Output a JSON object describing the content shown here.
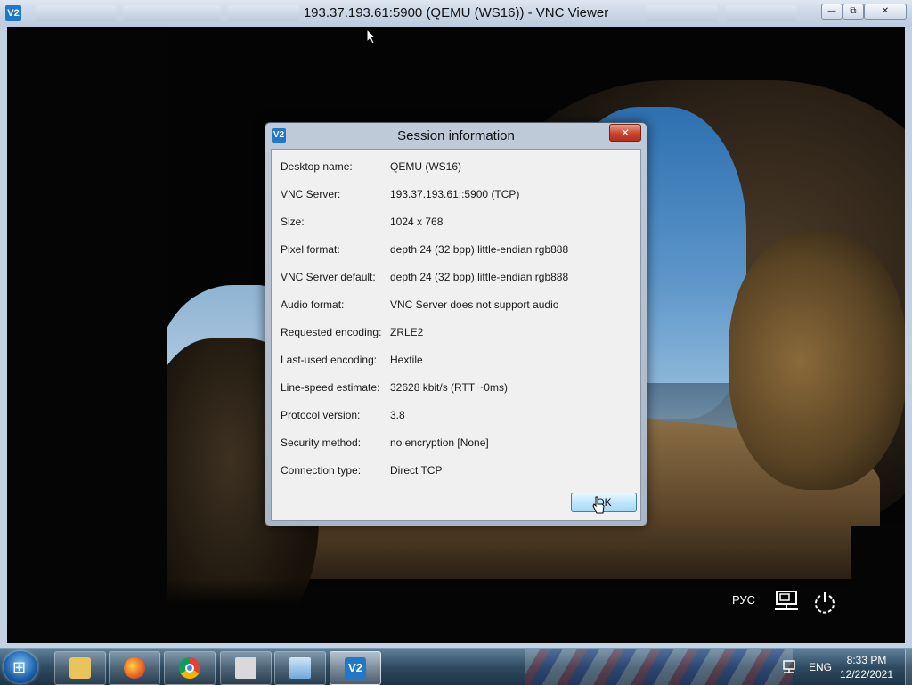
{
  "window": {
    "title": "193.37.193.61:5900 (QEMU (WS16)) - VNC Viewer",
    "logo_text": "V2",
    "minimize_glyph": "—",
    "maximize_glyph": "⧉",
    "close_glyph": "✕"
  },
  "lock_screen": {
    "language": "РУС",
    "network_icon": "network-icon",
    "power_icon": "power-icon"
  },
  "dialog": {
    "title": "Session information",
    "close_glyph": "✕",
    "rows": [
      {
        "label": "Desktop name:",
        "value": "QEMU (WS16)"
      },
      {
        "label": "VNC Server:",
        "value": "193.37.193.61::5900 (TCP)"
      },
      {
        "label": "Size:",
        "value": "1024 x 768"
      },
      {
        "label": "Pixel format:",
        "value": "depth 24 (32 bpp) little-endian rgb888"
      },
      {
        "label": "VNC Server default:",
        "value": "depth 24 (32 bpp) little-endian rgb888"
      },
      {
        "label": "Audio format:",
        "value": "VNC Server does not support audio"
      },
      {
        "label": "Requested encoding:",
        "value": "ZRLE2"
      },
      {
        "label": "Last-used encoding:",
        "value": "Hextile"
      },
      {
        "label": "Line-speed estimate:",
        "value": "32628 kbit/s (RTT ~0ms)"
      },
      {
        "label": "Protocol version:",
        "value": "3.8"
      },
      {
        "label": "Security method:",
        "value": "no encryption [None]"
      },
      {
        "label": "Connection type:",
        "value": "Direct TCP"
      }
    ],
    "ok_label": "OK"
  },
  "taskbar": {
    "start_glyph": "⊞",
    "apps": [
      {
        "name": "file-explorer",
        "icon": "folder-icon",
        "color": "#e8c45a"
      },
      {
        "name": "firefox",
        "icon": "firefox-icon",
        "color": "#e8601c"
      },
      {
        "name": "chrome",
        "icon": "chrome-icon",
        "color": "#3aa757"
      },
      {
        "name": "app-window",
        "icon": "app-window-icon",
        "color": "#b9b9b9"
      },
      {
        "name": "remote-desktop",
        "icon": "remote-desktop-icon",
        "color": "#7fb2e0"
      },
      {
        "name": "vnc-viewer",
        "icon": "vnc-viewer-icon",
        "color": "#1f78c8"
      }
    ],
    "language": "ENG",
    "time": "8:33 PM",
    "date": "12/22/2021"
  },
  "colors": {
    "accent": "#1f78c8",
    "close_red": "#c8432c",
    "ok_blue": "#bee6fd"
  }
}
